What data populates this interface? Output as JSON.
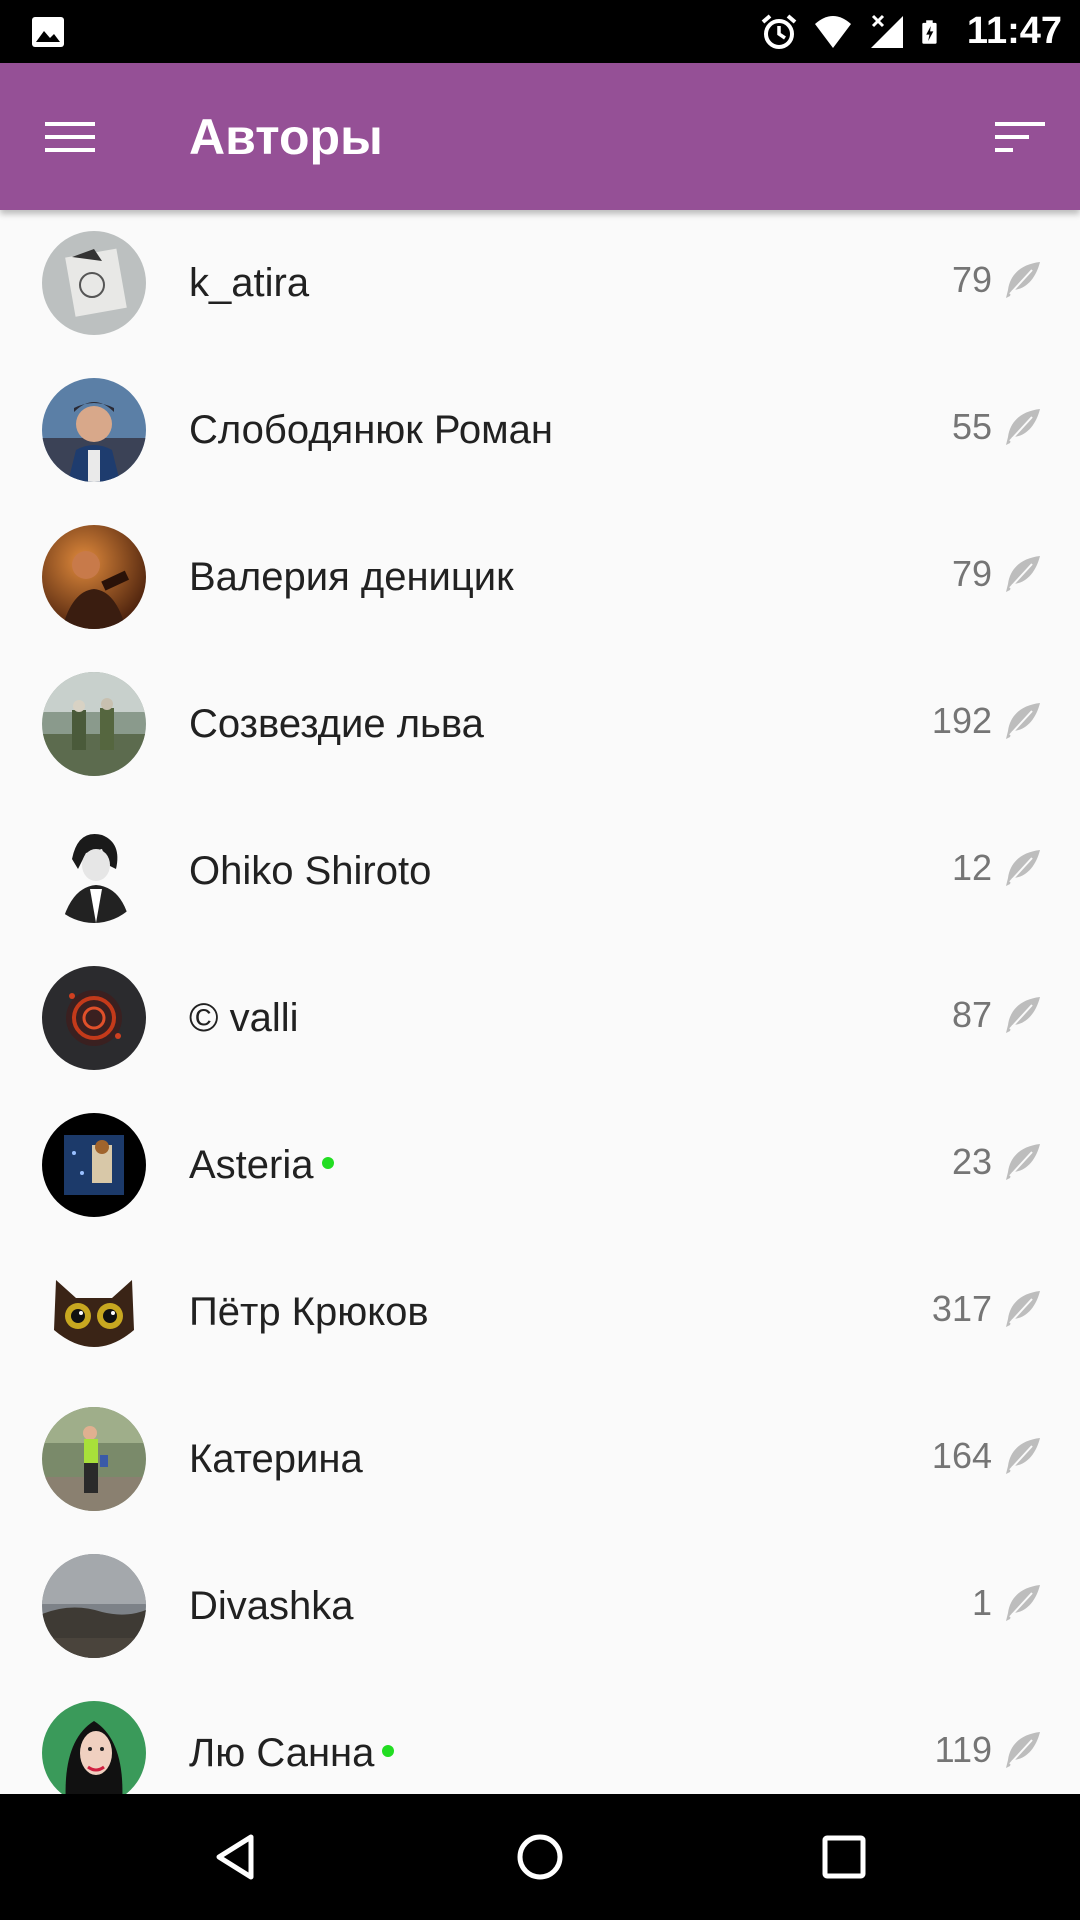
{
  "status_bar": {
    "time": "11:47",
    "icons": [
      "image-icon",
      "alarm-icon",
      "wifi-icon",
      "signal-icon",
      "battery-charging-icon"
    ]
  },
  "app_bar": {
    "title": "Авторы",
    "menu_icon": "hamburger-menu-icon",
    "sort_icon": "sort-icon",
    "color": "#955096"
  },
  "authors": [
    {
      "name": "k_atira",
      "count": "79",
      "online": false
    },
    {
      "name": "Слободянюк Роман",
      "count": "55",
      "online": false
    },
    {
      "name": "Валерия деницик",
      "count": "79",
      "online": false
    },
    {
      "name": "Созвездие льва",
      "count": "192",
      "online": false
    },
    {
      "name": "Ohiko Shiroto",
      "count": "12",
      "online": false
    },
    {
      "name": "© valli",
      "count": "87",
      "online": false
    },
    {
      "name": "Asteria",
      "count": "23",
      "online": true
    },
    {
      "name": "Пётр Крюков",
      "count": "317",
      "online": false
    },
    {
      "name": "Катерина",
      "count": "164",
      "online": false
    },
    {
      "name": "Divashka",
      "count": "1",
      "online": false
    },
    {
      "name": "Лю Санна",
      "count": "119",
      "online": true
    }
  ],
  "count_icon": "feather-icon",
  "online_color": "#22dd22",
  "nav_bar": {
    "icons": [
      "back-icon",
      "home-icon",
      "recents-icon"
    ]
  }
}
